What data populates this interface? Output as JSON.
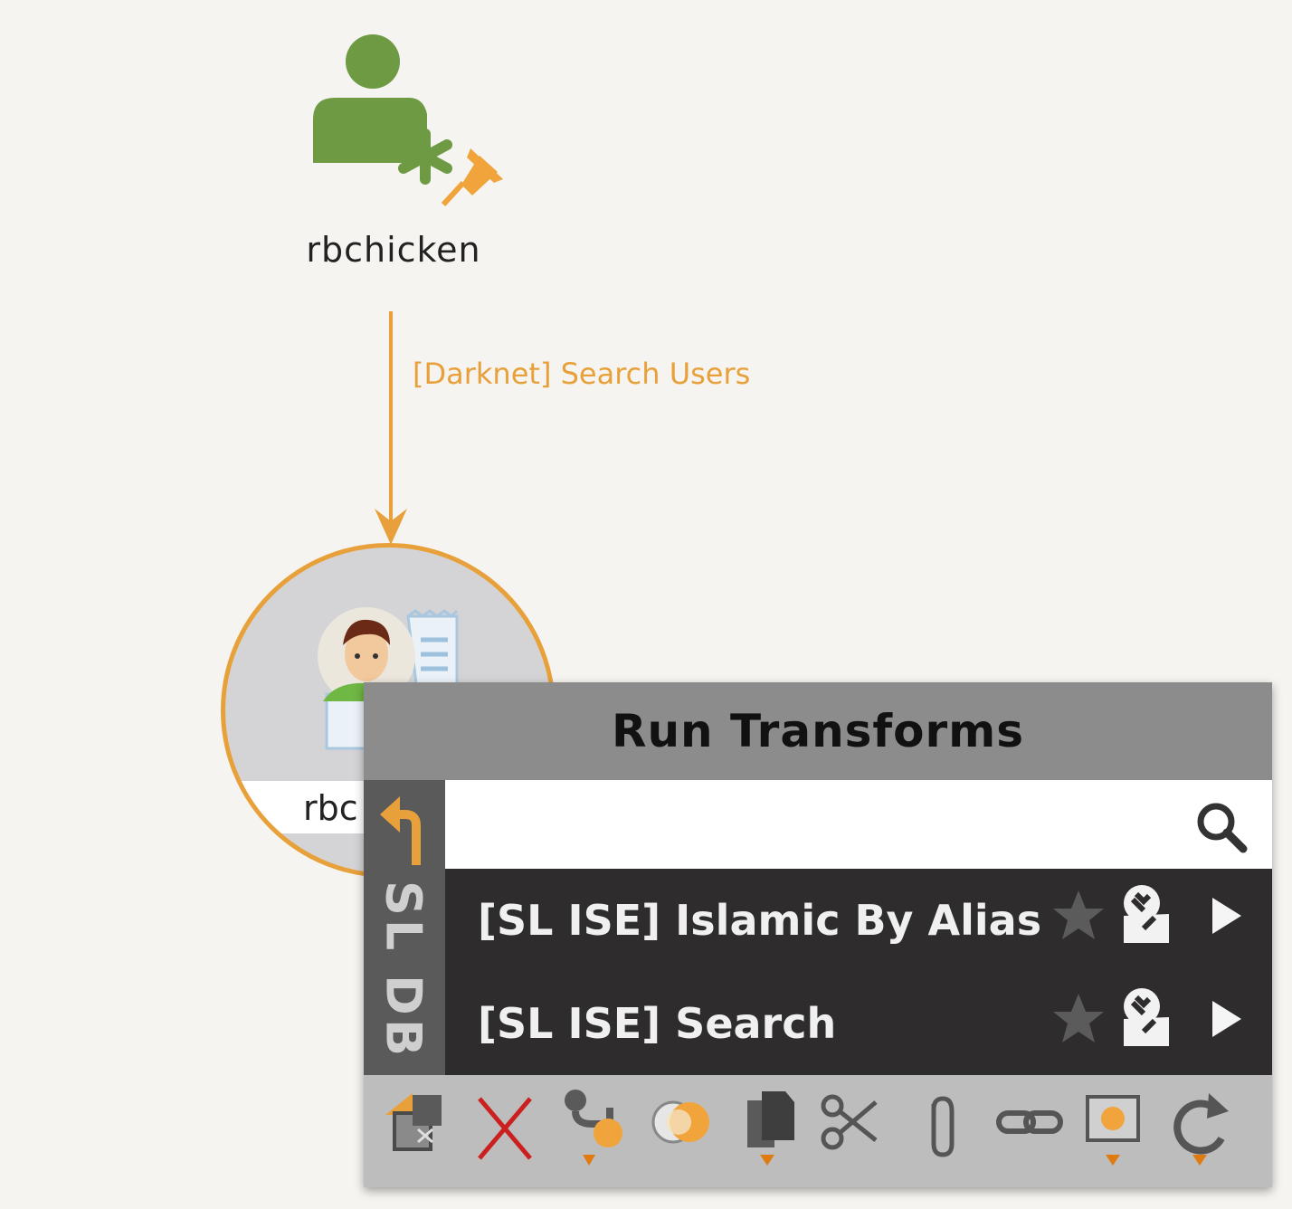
{
  "graph": {
    "top_node": {
      "label": "rbchicken",
      "icon": "user-entity-pinned-icon"
    },
    "edge": {
      "label": "[Darknet] Search Users",
      "color": "#e8a13a"
    },
    "selected_node": {
      "label": "rbc",
      "icon": "person-document-icon",
      "highlight_color": "#e8a13a"
    }
  },
  "popup": {
    "title": "Run Transforms",
    "side_label": "SL DB",
    "search": {
      "value": "",
      "placeholder": ""
    },
    "transforms": [
      {
        "label": "[SL ISE] Islamic By Alias"
      },
      {
        "label": "[SL ISE] Search"
      }
    ],
    "toolbar_icons": [
      "change-type-icon",
      "delete-icon",
      "merge-icon",
      "toggle-icon",
      "copy-icon",
      "cut-icon",
      "attach-icon",
      "link-icon",
      "select-icon",
      "refresh-icon"
    ]
  }
}
